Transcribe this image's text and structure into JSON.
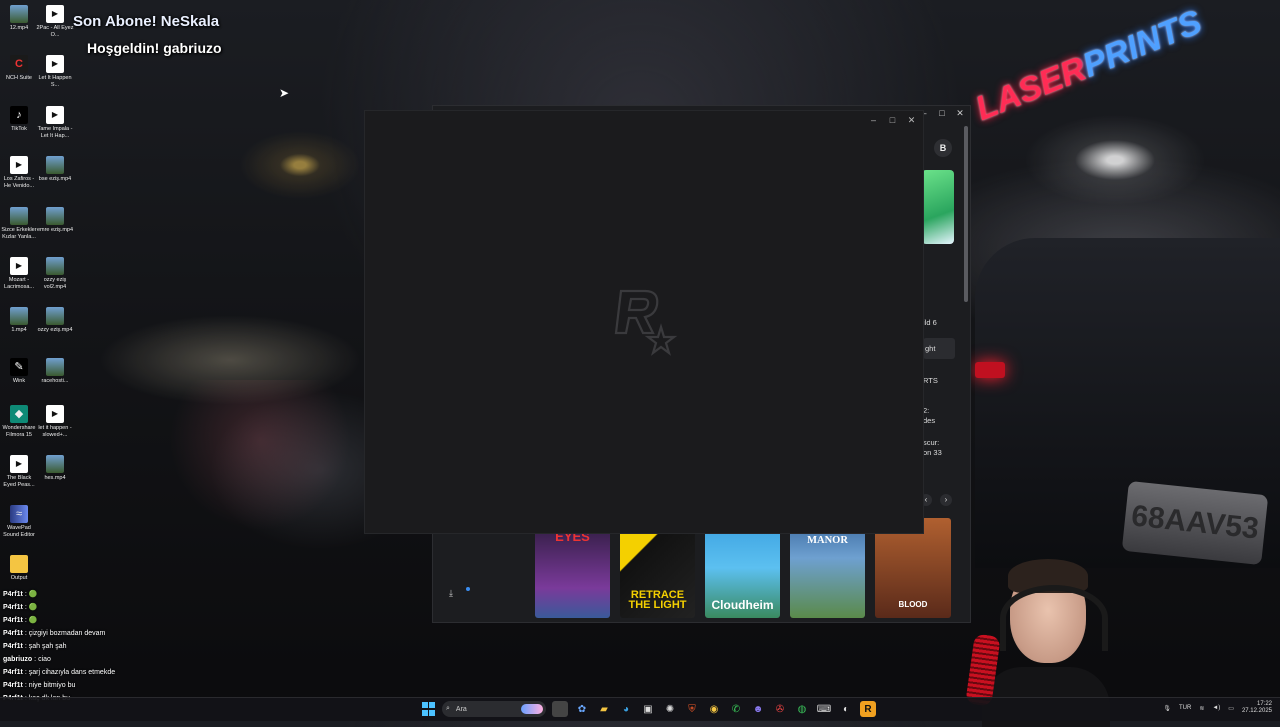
{
  "overlay": {
    "line1": "Son Abone! NeSkala",
    "line2": "Hoşgeldin! gabriuzo"
  },
  "desktop_icons": [
    {
      "label": "12.mp4",
      "icon": "image-icon"
    },
    {
      "label": "2Pac - All Eyez O...",
      "icon": "video-icon"
    },
    {
      "label": "NCH Suite",
      "icon": "nch-icon"
    },
    {
      "label": "Let It Happen S...",
      "icon": "video-icon"
    },
    {
      "label": "TikTok",
      "icon": "tiktok-icon"
    },
    {
      "label": "Tame Impala - Let It Hap...",
      "icon": "video-icon"
    },
    {
      "label": "Los Zafiros - He Venido...",
      "icon": "video-icon"
    },
    {
      "label": "bse eziş.mp4",
      "icon": "image-icon"
    },
    {
      "label": "Sizce Erkekler Kızlar Yanla...",
      "icon": "image-icon"
    },
    {
      "label": "emre eziş.mp4",
      "icon": "image-icon"
    },
    {
      "label": "Mozart - Lacrimosa...",
      "icon": "video-icon"
    },
    {
      "label": "ozzy eziş vol2.mp4",
      "icon": "image-icon"
    },
    {
      "label": "1.mp4",
      "icon": "image-icon"
    },
    {
      "label": "ozzy eziş.mp4",
      "icon": "image-icon"
    },
    {
      "label": "Wink",
      "icon": "wink-icon"
    },
    {
      "label": "racehosti...",
      "icon": "image-icon"
    },
    {
      "label": "Wondershare Filmora 15",
      "icon": "filmora-icon"
    },
    {
      "label": "let it happen - slowed+...",
      "icon": "video-icon"
    },
    {
      "label": "The Black Eyed Peas...",
      "icon": "video-icon"
    },
    {
      "label": "hes.mp4",
      "icon": "image-icon"
    },
    {
      "label": "WavePad Sound Editor",
      "icon": "wavepad-icon"
    },
    {
      "label": "Output",
      "icon": "folder-icon"
    }
  ],
  "chat": [
    {
      "user": "P4rf1t",
      "msg": "🟢"
    },
    {
      "user": "P4rf1t",
      "msg": "🟢"
    },
    {
      "user": "P4rf1t",
      "msg": "🟢"
    },
    {
      "user": "P4rf1t",
      "msg": "çizgiyi bozmadan devam"
    },
    {
      "user": "P4rf1t",
      "msg": "şah şah şah"
    },
    {
      "user": "gabriuzo",
      "msg": "ciao"
    },
    {
      "user": "P4rf1t",
      "msg": "şarj cihazıyla dans etmekde"
    },
    {
      "user": "P4rf1t",
      "msg": "niye bitmiyo bu"
    },
    {
      "user": "P4rf1t",
      "msg": "kaç dk lan bu"
    }
  ],
  "launcher": {
    "avatar_letter": "B",
    "side_items": [
      "ild 6",
      "ght",
      "RTS",
      "2:",
      "des",
      "scur:",
      "on 33"
    ],
    "games": [
      {
        "title": "GLOOMY EYES"
      },
      {
        "title": "RETRACE THE LIGHT"
      },
      {
        "title": "Cloudheim"
      },
      {
        "title": "BOTANY MANOR"
      },
      {
        "title": "BLOOD"
      }
    ],
    "nav_prev": "‹",
    "nav_next": "›"
  },
  "splash": {
    "window_controls": [
      "–",
      "□",
      "✕"
    ]
  },
  "background": {
    "sign_left": "LASER",
    "sign_right": "PRINTS",
    "plate": "68AAV53"
  },
  "taskbar": {
    "search_placeholder": "Ara",
    "language": "TUR",
    "time": "17:22",
    "date": "27.12.2025"
  },
  "colors": {
    "accent": "#4cc2ff",
    "splash_bg": "#1b1b1d",
    "launcher_bg": "#1c1d20"
  }
}
